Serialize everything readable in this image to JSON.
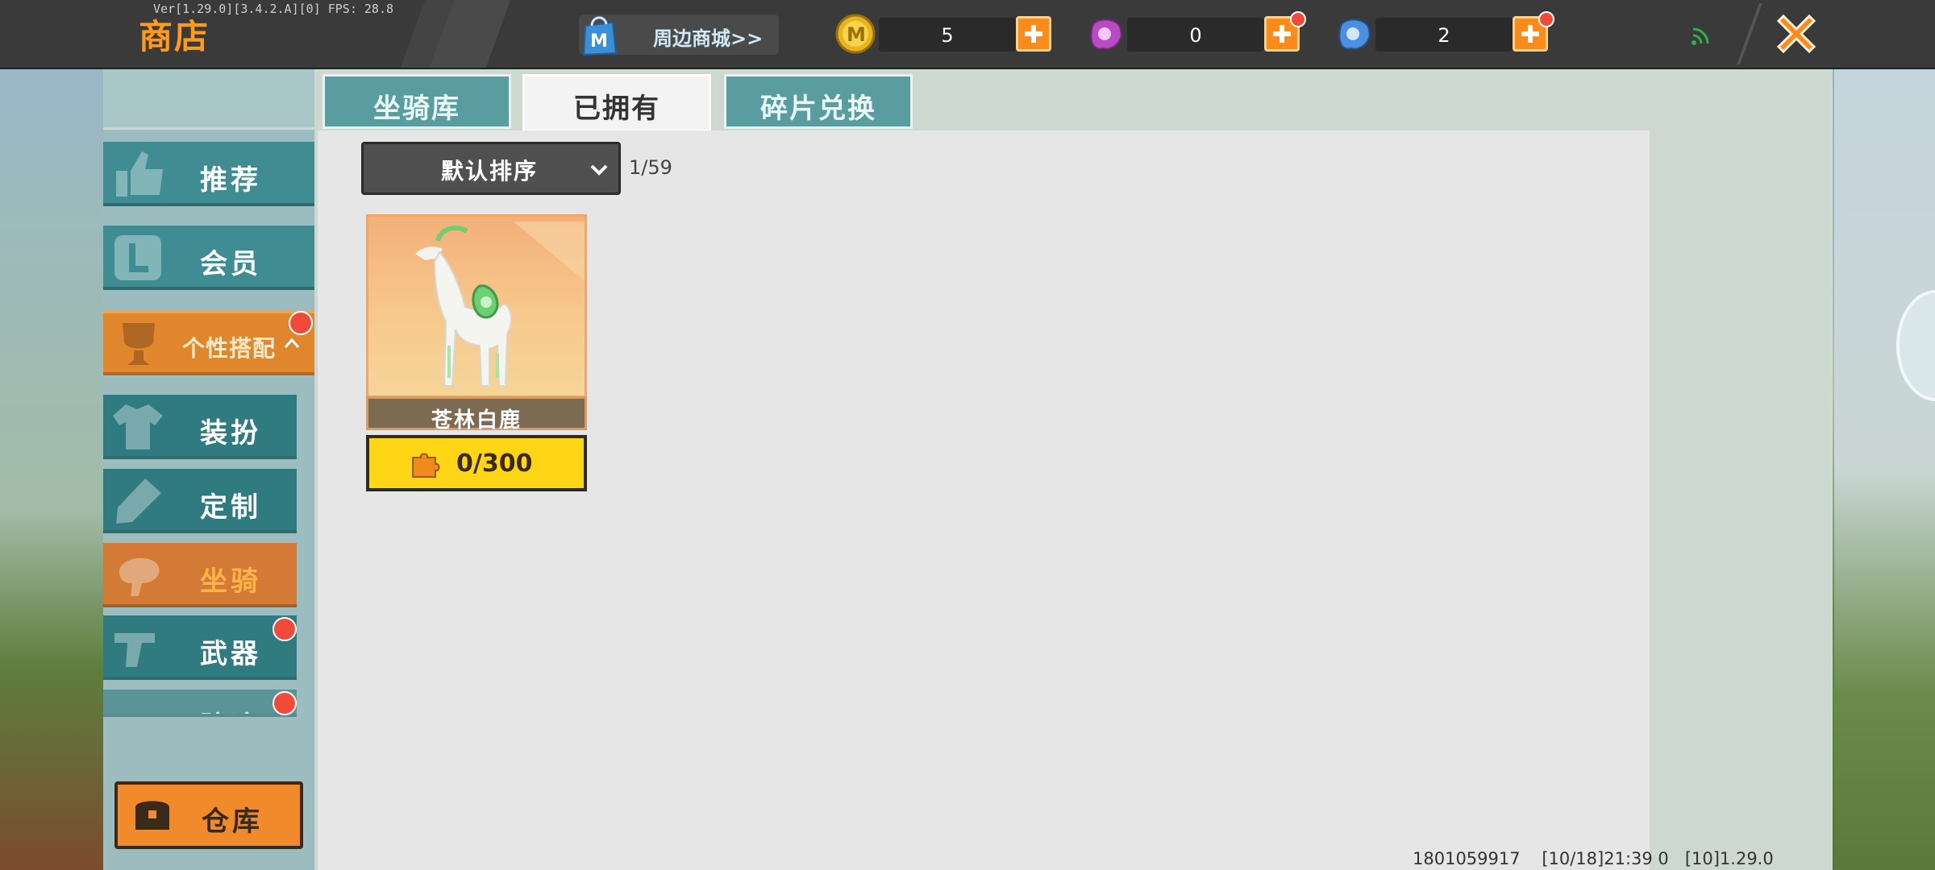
{
  "app": {
    "version_text": "Ver[1.29.0][3.4.2.A][0] FPS: 28.8",
    "title": "商店"
  },
  "topbar": {
    "mall_label": "周边商城>>",
    "currencies": [
      {
        "name": "coin",
        "value": "5",
        "has_badge": false
      },
      {
        "name": "pink-gem",
        "value": "0",
        "has_badge": true
      },
      {
        "name": "blue-gem",
        "value": "2",
        "has_badge": true
      }
    ]
  },
  "sidebar": {
    "items": [
      {
        "id": "recommend",
        "label": "推荐",
        "icon": "thumbs-up-icon"
      },
      {
        "id": "member",
        "label": "会员",
        "icon": "member-l-icon"
      },
      {
        "id": "personal",
        "label": "个性搭配",
        "icon": "trophy-icon",
        "expanded": true,
        "has_badge": true
      },
      {
        "id": "outfit",
        "label": "装扮",
        "icon": "shirt-icon"
      },
      {
        "id": "custom",
        "label": "定制",
        "icon": "pencil-icon"
      },
      {
        "id": "mount",
        "label": "坐骑",
        "icon": "mount-icon",
        "active": true
      },
      {
        "id": "weapon",
        "label": "武器",
        "icon": "revolver-icon",
        "has_badge": true
      },
      {
        "id": "trail",
        "label": "踪迹",
        "icon": "trail-icon",
        "has_badge": true
      }
    ],
    "warehouse_label": "仓库"
  },
  "tabs": [
    {
      "label": "坐骑库",
      "selected": false
    },
    {
      "label": "已拥有",
      "selected": true
    },
    {
      "label": "碎片兑换",
      "selected": false
    }
  ],
  "filter": {
    "sort_label": "默认排序",
    "page_count": "1/59"
  },
  "items": [
    {
      "name": "苍林白鹿",
      "progress_text": "0/300",
      "progress_fraction": 0.0
    }
  ],
  "footer": {
    "user_id": "1801059917",
    "timestamp": "[10/18]21:39 0",
    "build": "[10]1.29.0"
  },
  "colors": {
    "accent_orange": "#ff9a1f",
    "teal": "#3f8d92",
    "yellow": "#ffd616"
  }
}
